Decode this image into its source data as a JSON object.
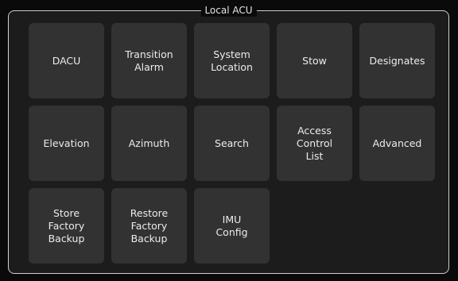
{
  "panel": {
    "title": "Local ACU",
    "buttons": [
      "DACU",
      "Transition\nAlarm",
      "System\nLocation",
      "Stow",
      "Designates",
      "Elevation",
      "Azimuth",
      "Search",
      "Access\nControl\nList",
      "Advanced",
      "Store\nFactory\nBackup",
      "Restore\nFactory\nBackup",
      "IMU\nConfig"
    ]
  }
}
